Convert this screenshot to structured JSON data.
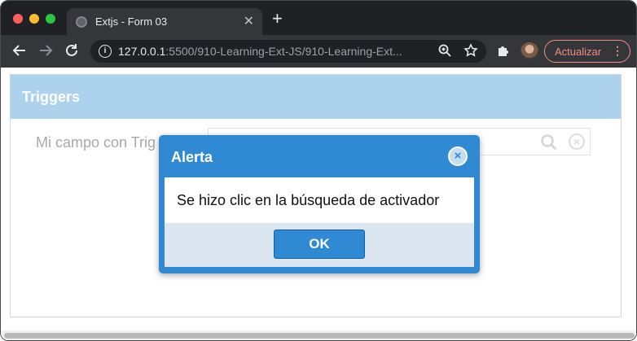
{
  "browser": {
    "tab_title": "Extjs - Form 03",
    "tab_close": "✕",
    "new_tab": "+",
    "url_host": "127.0.0.1",
    "url_rest": ":5500/910-Learning-Ext-JS/910-Learning-Ext...",
    "update_label": "Actualizar",
    "update_menu": "⋮"
  },
  "panel": {
    "title": "Triggers",
    "field_label": "Mi campo con Trig"
  },
  "dialog": {
    "title": "Alerta",
    "message": "Se hizo clic en la búsqueda de activador",
    "ok_label": "OK"
  },
  "icons": {
    "back": "back-arrow-icon",
    "forward": "forward-arrow-icon",
    "reload": "reload-icon",
    "info": "info-icon",
    "zoom": "zoom-icon",
    "star": "star-icon",
    "extensions": "puzzle-icon",
    "search_trigger": "search-icon",
    "clear_trigger": "clear-icon",
    "close": "close-icon"
  },
  "colors": {
    "panel_header": "#add2ed",
    "dialog_blue": "#2f8ad3",
    "update_accent": "#f28b82"
  }
}
